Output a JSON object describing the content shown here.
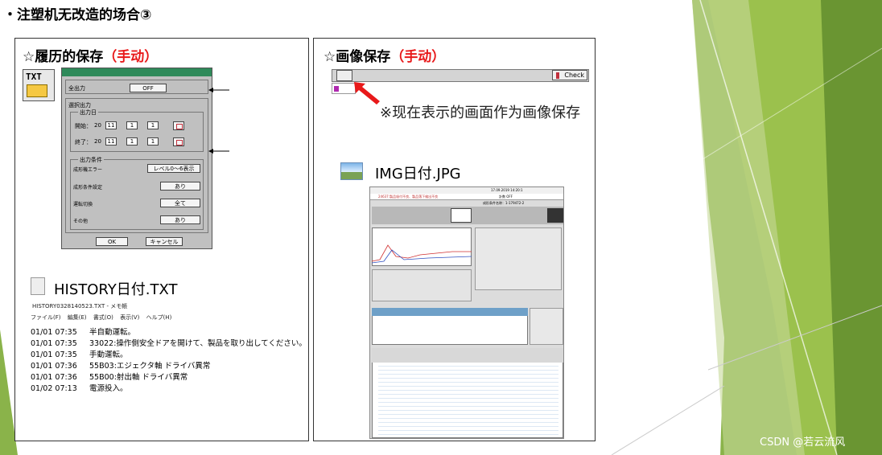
{
  "page": {
    "title": "・注塑机无改造的场合③",
    "watermark": "CSDN @若云流风"
  },
  "left_panel": {
    "title_main": "☆履历的保存",
    "title_paren": "（手动）",
    "txt_icon_label": "TXT",
    "dialog": {
      "all_output_label": "全出力",
      "all_output_value": "OFF",
      "select_output_label": "選択出力",
      "output_date_label": "出力日",
      "start_label": "開始：",
      "start_year": "20",
      "start_y2": "11",
      "start_month": "1",
      "start_day": "1",
      "end_label": "終了：",
      "end_year": "20",
      "end_y2": "11",
      "end_month": "1",
      "end_day": "1",
      "conditions_label": "出力条件",
      "conditions": [
        {
          "label": "成形機エラー",
          "value": "レベル0～6表示"
        },
        {
          "label": "成形条件設定",
          "value": "あり"
        },
        {
          "label": "運転切換",
          "value": "全て"
        },
        {
          "label": "その他",
          "value": "あり"
        }
      ],
      "ok": "OK",
      "cancel": "キャンセル"
    },
    "file_name": "HISTORY日付.TXT",
    "notepad": {
      "title": "HISTORY0328140523.TXT - メモ帳",
      "menu": [
        "ファイル(F)",
        "編集(E)",
        "書式(O)",
        "表示(V)",
        "ヘルプ(H)"
      ],
      "lines": [
        {
          "time": "01/01 07:35",
          "text": "半自動運転。"
        },
        {
          "time": "01/01 07:35",
          "text": "33022:操作側安全ドアを開けて、製品を取り出してください。"
        },
        {
          "time": "01/01 07:35",
          "text": "手動運転。"
        },
        {
          "time": "01/01 07:36",
          "text": "55B03:エジェクタ軸 ドライバ異常"
        },
        {
          "time": "01/01 07:36",
          "text": "55B00:射出軸 ドライバ異常"
        },
        {
          "time": "01/02 07:13",
          "text": "電源投入。"
        }
      ]
    }
  },
  "right_panel": {
    "title_main": "☆画像保存",
    "title_paren": "（手动）",
    "check_label": "Check",
    "note": "※现在表示的画面作为画像保存",
    "file_name": "IMG日付.JPG",
    "thumb": {
      "datetime": "17.09.2019  14:20:1",
      "alert": "24637:製品吸付不良、製品落下検出不良",
      "status": "計数 OFF",
      "condition": "成形条件名称：1-179472-2"
    }
  },
  "colors": {
    "accent_red": "#e8191a",
    "dialog_bar": "#2f8a5a",
    "deco_green": "#7cb342"
  }
}
